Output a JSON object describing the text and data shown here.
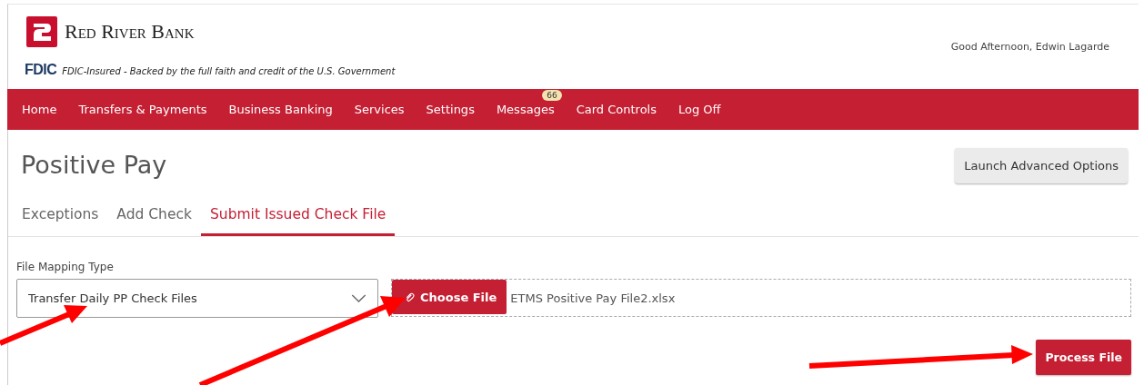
{
  "header": {
    "bank_name": "Red River Bank",
    "fdic_mark": "FDIC",
    "fdic_note": "FDIC-Insured - Backed by the full faith and credit of the U.S. Government",
    "greeting": "Good Afternoon, Edwin Lagarde"
  },
  "nav": [
    {
      "label": "Home"
    },
    {
      "label": "Transfers & Payments"
    },
    {
      "label": "Business Banking"
    },
    {
      "label": "Services"
    },
    {
      "label": "Settings"
    },
    {
      "label": "Messages",
      "badge": "66"
    },
    {
      "label": "Card Controls"
    },
    {
      "label": "Log Off"
    }
  ],
  "page": {
    "title": "Positive Pay",
    "advanced_button": "Launch Advanced Options"
  },
  "tabs": [
    {
      "label": "Exceptions",
      "selected": false
    },
    {
      "label": "Add Check",
      "selected": false
    },
    {
      "label": "Submit Issued Check File",
      "selected": true
    }
  ],
  "form": {
    "mapping_label": "File Mapping Type",
    "mapping_value": "Transfer Daily PP Check Files",
    "choose_button": "Choose File",
    "file_name": "ETMS Positive Pay File2.xlsx",
    "process_button": "Process File"
  }
}
